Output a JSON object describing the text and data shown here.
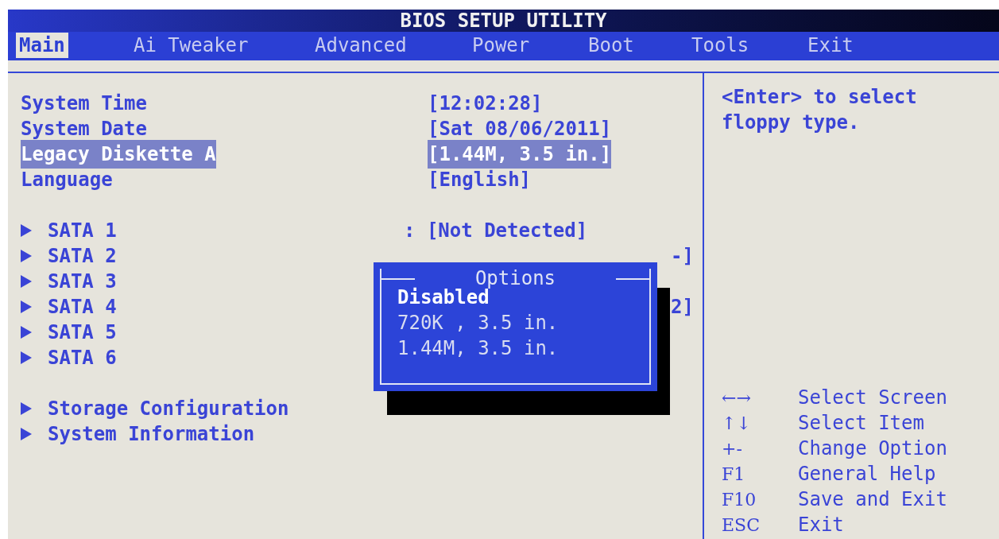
{
  "window": {
    "title": "BIOS SETUP UTILITY"
  },
  "tabs": [
    {
      "label": "Main",
      "selected": true
    },
    {
      "label": "Ai Tweaker",
      "selected": false
    },
    {
      "label": "Advanced",
      "selected": false
    },
    {
      "label": "Power",
      "selected": false
    },
    {
      "label": "Boot",
      "selected": false
    },
    {
      "label": "Tools",
      "selected": false
    },
    {
      "label": "Exit",
      "selected": false
    }
  ],
  "groups": [
    [
      {
        "label": "System Time",
        "value": "[12:02:28]",
        "selected": false,
        "submenu": false
      },
      {
        "label": "System Date",
        "value": "[Sat 08/06/2011]",
        "selected": false,
        "submenu": false
      },
      {
        "label": "Legacy Diskette A",
        "value": "[1.44M, 3.5 in.]",
        "selected": true,
        "submenu": false
      },
      {
        "label": "Language",
        "value": "[English]",
        "selected": false,
        "submenu": false
      }
    ],
    [
      {
        "label": "SATA 1",
        "value": ": [Not Detected]",
        "selected": false,
        "submenu": true
      },
      {
        "label": "SATA 2",
        "value_tail": "-]",
        "selected": false,
        "submenu": true
      },
      {
        "label": "SATA 3",
        "selected": false,
        "submenu": true
      },
      {
        "label": "SATA 4",
        "value_tail": "2]",
        "selected": false,
        "submenu": true
      },
      {
        "label": "SATA 5",
        "selected": false,
        "submenu": true
      },
      {
        "label": "SATA 6",
        "selected": false,
        "submenu": true
      }
    ],
    [
      {
        "label": "Storage Configuration",
        "selected": false,
        "submenu": true
      },
      {
        "label": "System Information",
        "selected": false,
        "submenu": true
      }
    ]
  ],
  "help": "<Enter> to select floppy type.",
  "keys": [
    {
      "key": "←→",
      "action": "Select Screen"
    },
    {
      "key": "↑↓",
      "action": "Select Item"
    },
    {
      "key": "+-",
      "action": "Change Option"
    },
    {
      "key": "F1",
      "action": "General Help"
    },
    {
      "key": "F10",
      "action": "Save and Exit"
    },
    {
      "key": "ESC",
      "action": "Exit"
    }
  ],
  "popup": {
    "title": "Options",
    "options": [
      {
        "label": "Disabled",
        "selected": true
      },
      {
        "label": "720K , 3.5 in.",
        "selected": false
      },
      {
        "label": "1.44M, 3.5 in.",
        "selected": false
      }
    ]
  }
}
